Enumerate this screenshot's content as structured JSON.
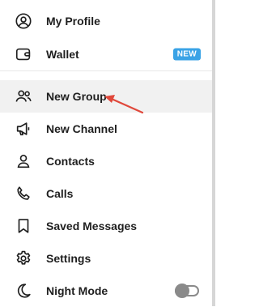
{
  "menu": {
    "items": [
      {
        "label": "My Profile",
        "icon": "user-circle-icon"
      },
      {
        "label": "Wallet",
        "icon": "wallet-icon",
        "badge": "NEW"
      },
      {
        "label": "New Group",
        "icon": "group-icon",
        "active": true
      },
      {
        "label": "New Channel",
        "icon": "megaphone-icon"
      },
      {
        "label": "Contacts",
        "icon": "person-icon"
      },
      {
        "label": "Calls",
        "icon": "phone-icon"
      },
      {
        "label": "Saved Messages",
        "icon": "bookmark-icon"
      },
      {
        "label": "Settings",
        "icon": "gear-icon"
      },
      {
        "label": "Night Mode",
        "icon": "moon-icon",
        "toggle": false
      }
    ]
  },
  "colors": {
    "badge": "#3aa3e6",
    "active_background": "#f1f1f1",
    "arrow": "#e0483b",
    "icon": "#1f1f1f"
  }
}
